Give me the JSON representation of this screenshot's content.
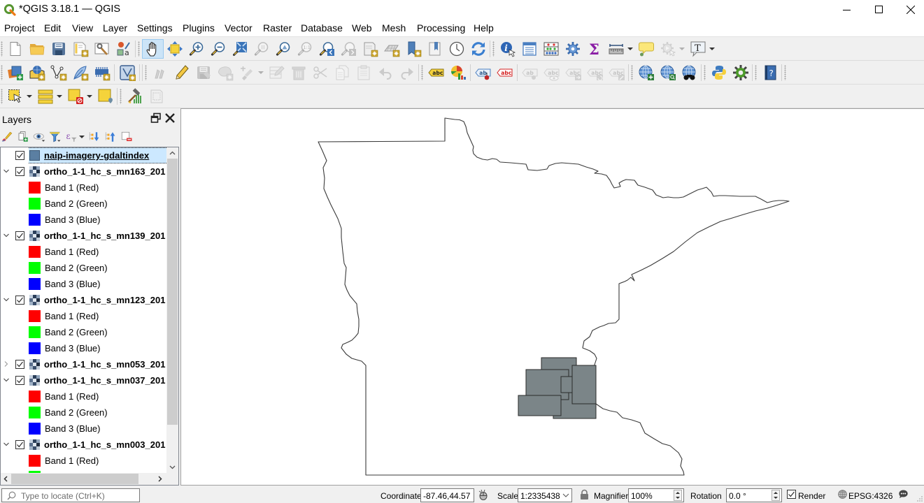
{
  "window": {
    "title": "*QGIS 3.18.1 — QGIS",
    "app_icon": "qgis-logo-icon",
    "controls": [
      "minimize-icon",
      "maximize-icon",
      "close-icon"
    ]
  },
  "menu": {
    "items": [
      "Project",
      "Edit",
      "View",
      "Layer",
      "Settings",
      "Plugins",
      "Vector",
      "Raster",
      "Database",
      "Web",
      "Mesh",
      "Processing",
      "Help"
    ]
  },
  "toolbars": {
    "rows": [
      [
        {
          "icon": "new-project-icon"
        },
        {
          "icon": "open-project-icon"
        },
        {
          "icon": "save-project-icon"
        },
        {
          "icon": "new-print-layout-icon"
        },
        {
          "icon": "layout-manager-icon"
        },
        {
          "icon": "style-manager-icon"
        },
        {
          "type": "toolbar-break"
        },
        {
          "icon": "pan-icon",
          "active": true
        },
        {
          "icon": "pan-to-selection-icon"
        },
        {
          "icon": "zoom-in-icon"
        },
        {
          "icon": "zoom-out-icon"
        },
        {
          "icon": "zoom-full-icon"
        },
        {
          "icon": "zoom-to-selection-icon",
          "enabled": false
        },
        {
          "icon": "zoom-to-layer-icon"
        },
        {
          "icon": "zoom-native-icon",
          "enabled": false
        },
        {
          "icon": "zoom-last-icon"
        },
        {
          "icon": "zoom-next-icon",
          "enabled": false
        },
        {
          "icon": "new-map-view-icon"
        },
        {
          "icon": "new-3d-map-view-icon"
        },
        {
          "icon": "new-spatial-bookmark-icon"
        },
        {
          "icon": "show-bookmarks-icon"
        },
        {
          "icon": "temporal-controller-icon"
        },
        {
          "icon": "refresh-icon"
        },
        {
          "type": "toolbar-break"
        },
        {
          "icon": "identify-icon"
        },
        {
          "icon": "attribute-table-icon"
        },
        {
          "icon": "field-calculator-icon"
        },
        {
          "icon": "processing-toolbox-icon"
        },
        {
          "icon": "statistical-summary-icon"
        },
        {
          "icon": "measure-icon",
          "dropdown": true
        },
        {
          "icon": "map-tips-icon"
        },
        {
          "icon": "actions-icon",
          "enabled": false,
          "dropdown": true
        },
        {
          "icon": "text-annotation-icon",
          "dropdown": true
        }
      ],
      [
        {
          "icon": "data-source-manager-icon"
        },
        {
          "icon": "new-geopackage-layer-icon"
        },
        {
          "icon": "new-shapefile-layer-icon"
        },
        {
          "icon": "new-spatialite-layer-icon"
        },
        {
          "icon": "new-memory-layer-icon"
        },
        {
          "type": "separator"
        },
        {
          "icon": "new-virtual-layer-icon"
        },
        {
          "type": "separator"
        },
        {
          "type": "toolbar-break"
        },
        {
          "icon": "current-edits-icon",
          "enabled": false
        },
        {
          "icon": "toggle-editing-icon"
        },
        {
          "icon": "save-layer-edits-icon",
          "enabled": false
        },
        {
          "icon": "add-feature-icon",
          "enabled": false
        },
        {
          "icon": "vertex-tool-icon",
          "enabled": false,
          "dropdown": true
        },
        {
          "icon": "modify-attributes-icon",
          "enabled": false
        },
        {
          "icon": "delete-selected-icon",
          "enabled": false
        },
        {
          "icon": "cut-features-icon",
          "enabled": false
        },
        {
          "icon": "copy-features-icon",
          "enabled": false
        },
        {
          "icon": "paste-features-icon",
          "enabled": false
        },
        {
          "icon": "undo-icon",
          "enabled": false
        },
        {
          "icon": "redo-icon",
          "enabled": false
        },
        {
          "type": "toolbar-break"
        },
        {
          "icon": "layer-labeling-icon"
        },
        {
          "icon": "layer-diagram-icon"
        },
        {
          "type": "separator"
        },
        {
          "icon": "pin-labels-icon"
        },
        {
          "icon": "highlight-pinned-labels-icon"
        },
        {
          "type": "separator"
        },
        {
          "icon": "show-pinned-labels-icon",
          "enabled": false
        },
        {
          "icon": "show-hide-labels-icon",
          "enabled": false
        },
        {
          "icon": "move-label-icon",
          "enabled": false
        },
        {
          "icon": "rotate-label-icon",
          "enabled": false
        },
        {
          "icon": "change-label-icon",
          "enabled": false
        },
        {
          "type": "toolbar-break"
        },
        {
          "icon": "add-wms-layer-icon"
        },
        {
          "icon": "search-web-layer-icon"
        },
        {
          "icon": "metasearch-icon"
        },
        {
          "type": "toolbar-break"
        },
        {
          "icon": "python-console-icon"
        },
        {
          "icon": "plugin-reloader-icon"
        },
        {
          "type": "toolbar-break"
        },
        {
          "icon": "help-contents-icon"
        },
        {
          "type": "toolbar-break"
        }
      ],
      [
        {
          "icon": "select-features-icon",
          "dropdown": true
        },
        {
          "icon": "select-by-value-icon",
          "dropdown": true
        },
        {
          "icon": "deselect-all-icon",
          "dropdown": true
        },
        {
          "icon": "select-by-location-icon"
        },
        {
          "type": "toolbar-break"
        },
        {
          "icon": "grass-tools-icon"
        },
        {
          "icon": "grass-region-icon",
          "enabled": false
        }
      ]
    ]
  },
  "layers_panel": {
    "title": "Layers",
    "dock_buttons": [
      "float-panel-icon",
      "close-panel-icon"
    ],
    "tools": [
      {
        "icon": "open-layer-styling-icon"
      },
      {
        "icon": "add-group-icon"
      },
      {
        "icon": "manage-map-themes-icon"
      },
      {
        "icon": "filter-legend-icon"
      },
      {
        "icon": "filter-by-expression-icon",
        "dropdown": true
      },
      {
        "icon": "expand-all-icon"
      },
      {
        "icon": "collapse-all-icon"
      },
      {
        "icon": "remove-layer-icon"
      }
    ],
    "items": [
      {
        "kind": "layer",
        "name": "naip-imagery-gdaltindex",
        "checked": true,
        "selected": true,
        "expander": "none",
        "symbol": "polygon-fill",
        "symbol_color": "#5b7fa2"
      },
      {
        "kind": "layer",
        "name": "ortho_1-1_hc_s_mn163_201",
        "checked": true,
        "expander": "expanded",
        "symbol": "raster"
      },
      {
        "kind": "band",
        "label": "Band 1 (Red)",
        "color": "#ff0000"
      },
      {
        "kind": "band",
        "label": "Band 2 (Green)",
        "color": "#00ff00"
      },
      {
        "kind": "band",
        "label": "Band 3 (Blue)",
        "color": "#0000ff"
      },
      {
        "kind": "layer",
        "name": "ortho_1-1_hc_s_mn139_201",
        "checked": true,
        "expander": "expanded",
        "symbol": "raster"
      },
      {
        "kind": "band",
        "label": "Band 1 (Red)",
        "color": "#ff0000"
      },
      {
        "kind": "band",
        "label": "Band 2 (Green)",
        "color": "#00ff00"
      },
      {
        "kind": "band",
        "label": "Band 3 (Blue)",
        "color": "#0000ff"
      },
      {
        "kind": "layer",
        "name": "ortho_1-1_hc_s_mn123_201",
        "checked": true,
        "expander": "expanded",
        "symbol": "raster"
      },
      {
        "kind": "band",
        "label": "Band 1 (Red)",
        "color": "#ff0000"
      },
      {
        "kind": "band",
        "label": "Band 2 (Green)",
        "color": "#00ff00"
      },
      {
        "kind": "band",
        "label": "Band 3 (Blue)",
        "color": "#0000ff"
      },
      {
        "kind": "layer",
        "name": "ortho_1-1_hc_s_mn053_201",
        "checked": true,
        "expander": "collapsed",
        "symbol": "raster"
      },
      {
        "kind": "layer",
        "name": "ortho_1-1_hc_s_mn037_201",
        "checked": true,
        "expander": "expanded",
        "symbol": "raster"
      },
      {
        "kind": "band",
        "label": "Band 1 (Red)",
        "color": "#ff0000"
      },
      {
        "kind": "band",
        "label": "Band 2 (Green)",
        "color": "#00ff00"
      },
      {
        "kind": "band",
        "label": "Band 3 (Blue)",
        "color": "#0000ff"
      },
      {
        "kind": "layer",
        "name": "ortho_1-1_hc_s_mn003_201",
        "checked": true,
        "expander": "expanded",
        "symbol": "raster"
      },
      {
        "kind": "band",
        "label": "Band 1 (Red)",
        "color": "#ff0000"
      },
      {
        "kind": "band",
        "label": "",
        "color": "#00ff00"
      }
    ]
  },
  "map": {
    "background": "#ffffff",
    "boundary_color": "#3a3a3a",
    "footprint_fill": "#7b8588",
    "footprint_stroke": "#2a2a2a"
  },
  "statusbar": {
    "locator_placeholder": "Type to locate (Ctrl+K)",
    "coordinate_label": "Coordinate",
    "coordinate_value": "-87.46,44.57",
    "scale_label": "Scale",
    "scale_value": "1:2335438",
    "magnifier_label": "Magnifier",
    "magnifier_value": "100%",
    "rotation_label": "Rotation",
    "rotation_value": "0.0 °",
    "render_label": "Render",
    "render_checked": true,
    "crs": "EPSG:4326"
  }
}
